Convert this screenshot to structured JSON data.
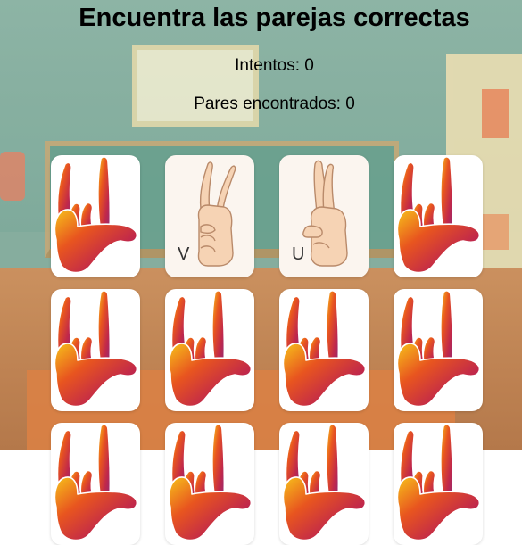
{
  "game": {
    "title": "Encuentra las parejas correctas",
    "attempts_text": "Intentos: 0",
    "pairs_text": "Pares encontrados: 0",
    "attempts": 0,
    "pairs_found": 0
  },
  "cards": [
    {
      "state": "hidden"
    },
    {
      "state": "revealed",
      "letter": "V",
      "sign": "v-hand-sign"
    },
    {
      "state": "revealed",
      "letter": "U",
      "sign": "u-hand-sign"
    },
    {
      "state": "hidden"
    },
    {
      "state": "hidden"
    },
    {
      "state": "hidden"
    },
    {
      "state": "hidden"
    },
    {
      "state": "hidden"
    },
    {
      "state": "hidden"
    },
    {
      "state": "hidden"
    },
    {
      "state": "hidden"
    },
    {
      "state": "hidden"
    }
  ],
  "colors": {
    "card_back_gradient": [
      "#f7c21a",
      "#e8551f",
      "#c1284a",
      "#8c2a7a"
    ],
    "skin": "#f6d3b4",
    "skin_outline": "#b98a6a"
  }
}
